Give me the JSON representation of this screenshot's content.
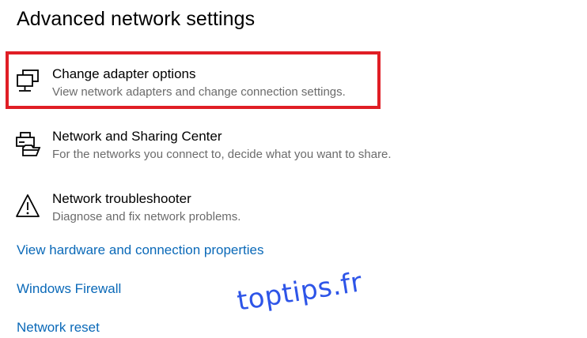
{
  "page": {
    "title": "Advanced network settings"
  },
  "options": [
    {
      "title": "Change adapter options",
      "description": "View network adapters and change connection settings.",
      "icon": "network-adapter-icon"
    },
    {
      "title": "Network and Sharing Center",
      "description": "For the networks you connect to, decide what you want to share.",
      "icon": "sharing-center-icon"
    },
    {
      "title": "Network troubleshooter",
      "description": "Diagnose and fix network problems.",
      "icon": "warning-icon"
    }
  ],
  "links": {
    "hardware_properties": "View hardware and connection properties",
    "firewall": "Windows Firewall",
    "network_reset": "Network reset"
  },
  "watermark": "toptips.fr",
  "colors": {
    "link": "#0a69b8",
    "highlight": "#e01e25",
    "description": "#6b6b6b",
    "watermark": "#2e55e8"
  }
}
